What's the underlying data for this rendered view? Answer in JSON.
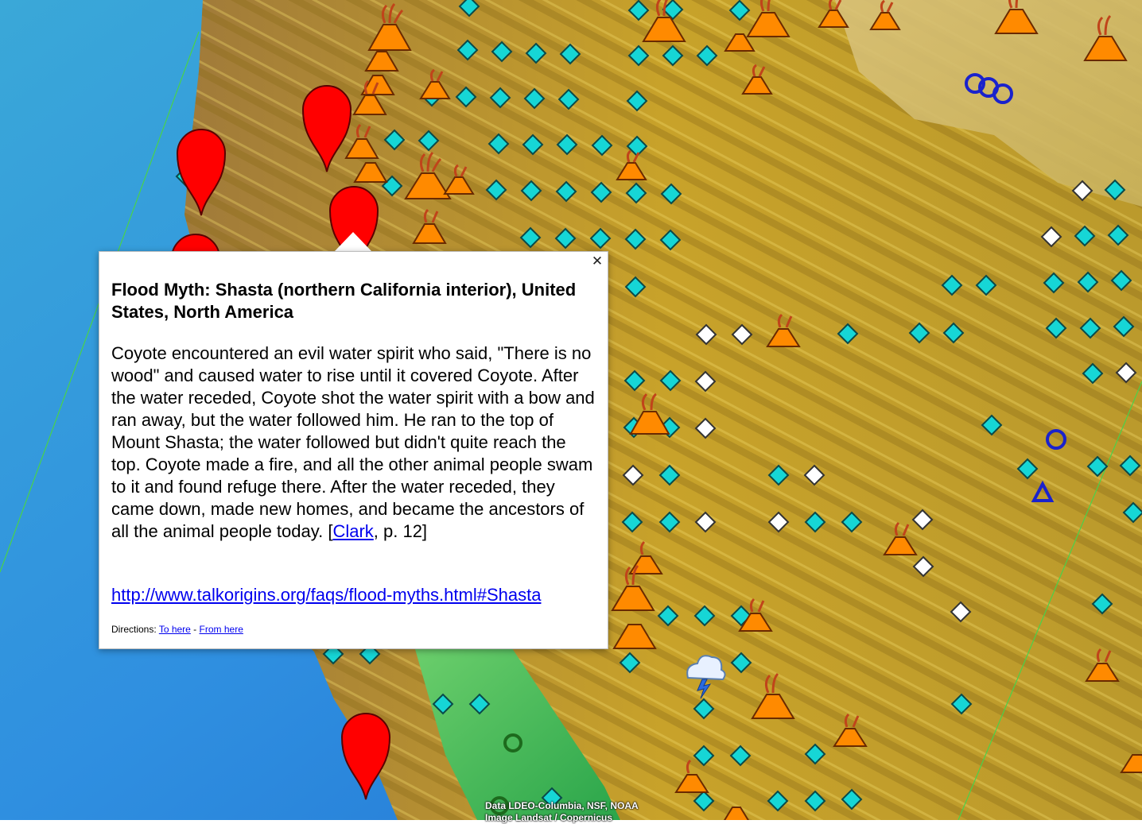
{
  "popup": {
    "title": "Flood Myth: Shasta (northern California interior), United States, North America",
    "body_before_link": "Coyote encountered an evil water spirit who said, \"There is no wood\" and caused water to rise until it covered Coyote. After the water receded, Coyote shot the water spirit with a bow and ran away, but the water followed him. He ran to the top of Mount Shasta; the water followed but didn't quite reach the top. Coyote made a fire, and all the other animal people swam to it and found refuge there. After the water receded, they came down, made new homes, and became the ancestors of all the animal people today. [",
    "body_link": "Clark",
    "body_after_link": ", p. 12]",
    "url": "http://www.talkorigins.org/faqs/flood-myths.html#Shasta",
    "directions_label": "Directions: ",
    "to_here": "To here",
    "separator": " - ",
    "from_here": "From here",
    "close_icon": "close-icon"
  },
  "attribution": {
    "line1": "Data LDEO-Columbia, NSF, NOAA",
    "line2": "Image Landsat / Copernicus"
  },
  "colors": {
    "pin": "#ff0000",
    "diamond_cyan": "#16d6d6",
    "diamond_white": "#ffffff",
    "volcano": "#ff8a00",
    "blue_marker": "#1a22cc",
    "link": "#0000ee"
  }
}
